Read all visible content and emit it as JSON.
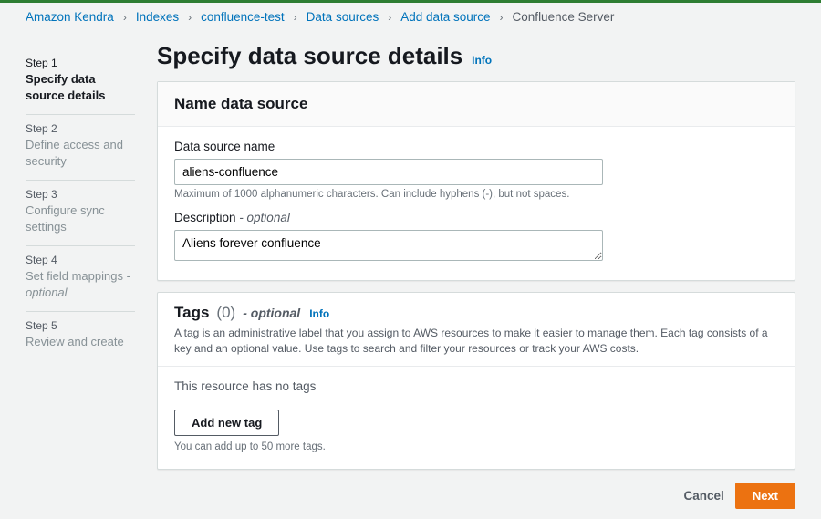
{
  "breadcrumb": {
    "items": [
      "Amazon Kendra",
      "Indexes",
      "confluence-test",
      "Data sources",
      "Add data source"
    ],
    "current": "Confluence Server"
  },
  "steps": [
    {
      "label": "Step 1",
      "title": "Specify data source details",
      "active": true
    },
    {
      "label": "Step 2",
      "title": "Define access and security"
    },
    {
      "label": "Step 3",
      "title": "Configure sync settings"
    },
    {
      "label": "Step 4",
      "title": "Set field mappings - ",
      "optional": "optional"
    },
    {
      "label": "Step 5",
      "title": "Review and create"
    }
  ],
  "header": {
    "title": "Specify data source details",
    "info": "Info"
  },
  "namePanel": {
    "title": "Name data source",
    "nameLabel": "Data source name",
    "nameValue": "aliens-confluence",
    "nameHint": "Maximum of 1000 alphanumeric characters. Can include hyphens (-), but not spaces.",
    "descLabel": "Description",
    "descOptional": "- optional",
    "descValue": "Aliens forever confluence"
  },
  "tagsPanel": {
    "title": "Tags",
    "count": "(0)",
    "dash": "-",
    "optional": "optional",
    "info": "Info",
    "desc": "A tag is an administrative label that you assign to AWS resources to make it easier to manage them. Each tag consists of a key and an optional value. Use tags to search and filter your resources or track your AWS costs.",
    "empty": "This resource has no tags",
    "addBtn": "Add new tag",
    "limit": "You can add up to 50 more tags."
  },
  "footer": {
    "cancel": "Cancel",
    "next": "Next"
  }
}
